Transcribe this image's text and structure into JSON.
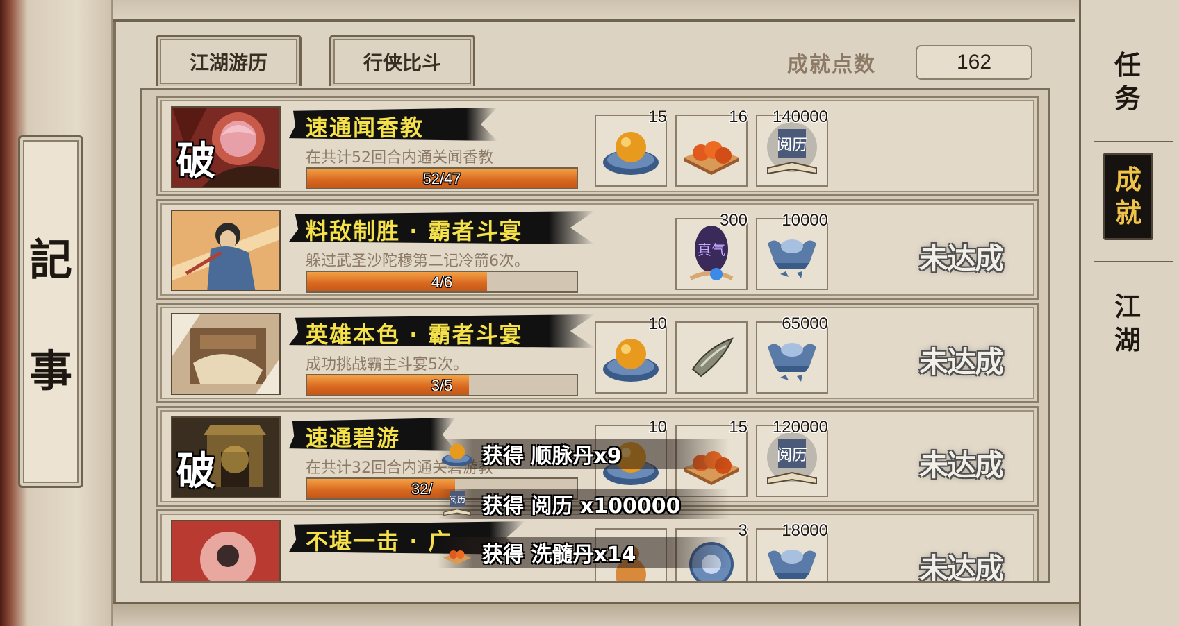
{
  "left_panel": {
    "chars": [
      "記",
      "事"
    ]
  },
  "tabs": [
    {
      "label": "江湖游历"
    },
    {
      "label": "行侠比斗"
    }
  ],
  "score": {
    "label": "成就点数",
    "value": "162"
  },
  "right_tabs": [
    {
      "label": "任务",
      "chars": [
        "任",
        "务"
      ],
      "active": false
    },
    {
      "label": "成就",
      "chars": [
        "成",
        "就"
      ],
      "active": true
    },
    {
      "label": "江湖",
      "chars": [
        "江",
        "湖"
      ],
      "active": false
    }
  ],
  "achievements": [
    {
      "title": "速通闻香教",
      "desc": "在共计52回合内通关闻香教",
      "progress_text": "52/47",
      "progress_fraction": 1.0,
      "portrait_label": "破",
      "rewards": [
        {
          "icon": "orb-dish-icon",
          "qty": "15"
        },
        {
          "icon": "pill-tray-icon",
          "qty": "16"
        },
        {
          "icon": "experience-book-icon",
          "qty": "140000",
          "text": "阅历"
        }
      ],
      "status": ""
    },
    {
      "title": "料敌制胜 · 霸者斗宴",
      "desc": "躲过武圣沙陀穆第二记冷箭6次。",
      "progress_text": "4/6",
      "progress_fraction": 0.667,
      "portrait_label": "",
      "rewards": [
        {
          "icon": "qi-orb-icon",
          "qty": "300",
          "text": "真气"
        },
        {
          "icon": "silver-ingot-icon",
          "qty": "10000"
        }
      ],
      "status": "未达成"
    },
    {
      "title": "英雄本色 · 霸者斗宴",
      "desc": "成功挑战霸主斗宴5次。",
      "progress_text": "3/5",
      "progress_fraction": 0.6,
      "portrait_label": "",
      "rewards": [
        {
          "icon": "orb-dish-icon",
          "qty": "10"
        },
        {
          "icon": "blade-fragment-icon",
          "qty": ""
        },
        {
          "icon": "silver-ingot-icon",
          "qty": "65000"
        }
      ],
      "status": "未达成"
    },
    {
      "title": "速通碧游",
      "desc": "在共计32回合内通关碧游教",
      "progress_text": "32/",
      "progress_fraction": 0.55,
      "portrait_label": "破",
      "rewards": [
        {
          "icon": "orb-dish-icon",
          "qty": "10"
        },
        {
          "icon": "pill-tray-icon",
          "qty": "15"
        },
        {
          "icon": "experience-book-icon",
          "qty": "120000",
          "text": "阅历"
        }
      ],
      "status": "未达成"
    },
    {
      "title": "不堪一击 · 广",
      "desc": "",
      "progress_text": "",
      "progress_fraction": 0,
      "portrait_label": "",
      "rewards": [
        {
          "icon": "potion-gourd-icon",
          "qty": ""
        },
        {
          "icon": "compass-icon",
          "qty": "3"
        },
        {
          "icon": "silver-ingot-icon",
          "qty": "18000"
        }
      ],
      "status": "未达成"
    }
  ],
  "toasts": [
    {
      "icon": "orb-dish-icon",
      "text": "获得 顺脉丹x9"
    },
    {
      "icon": "experience-book-icon",
      "icon_text": "阅历",
      "text": "获得 阅历 x100000"
    },
    {
      "icon": "pill-tray-icon",
      "text": "获得 洗髓丹x14"
    }
  ],
  "colors": {
    "paper": "#ddd3c2",
    "title_yellow": "#f5e14a",
    "progress_orange": "#d8671e",
    "active_tab_gold": "#f0c34a"
  }
}
